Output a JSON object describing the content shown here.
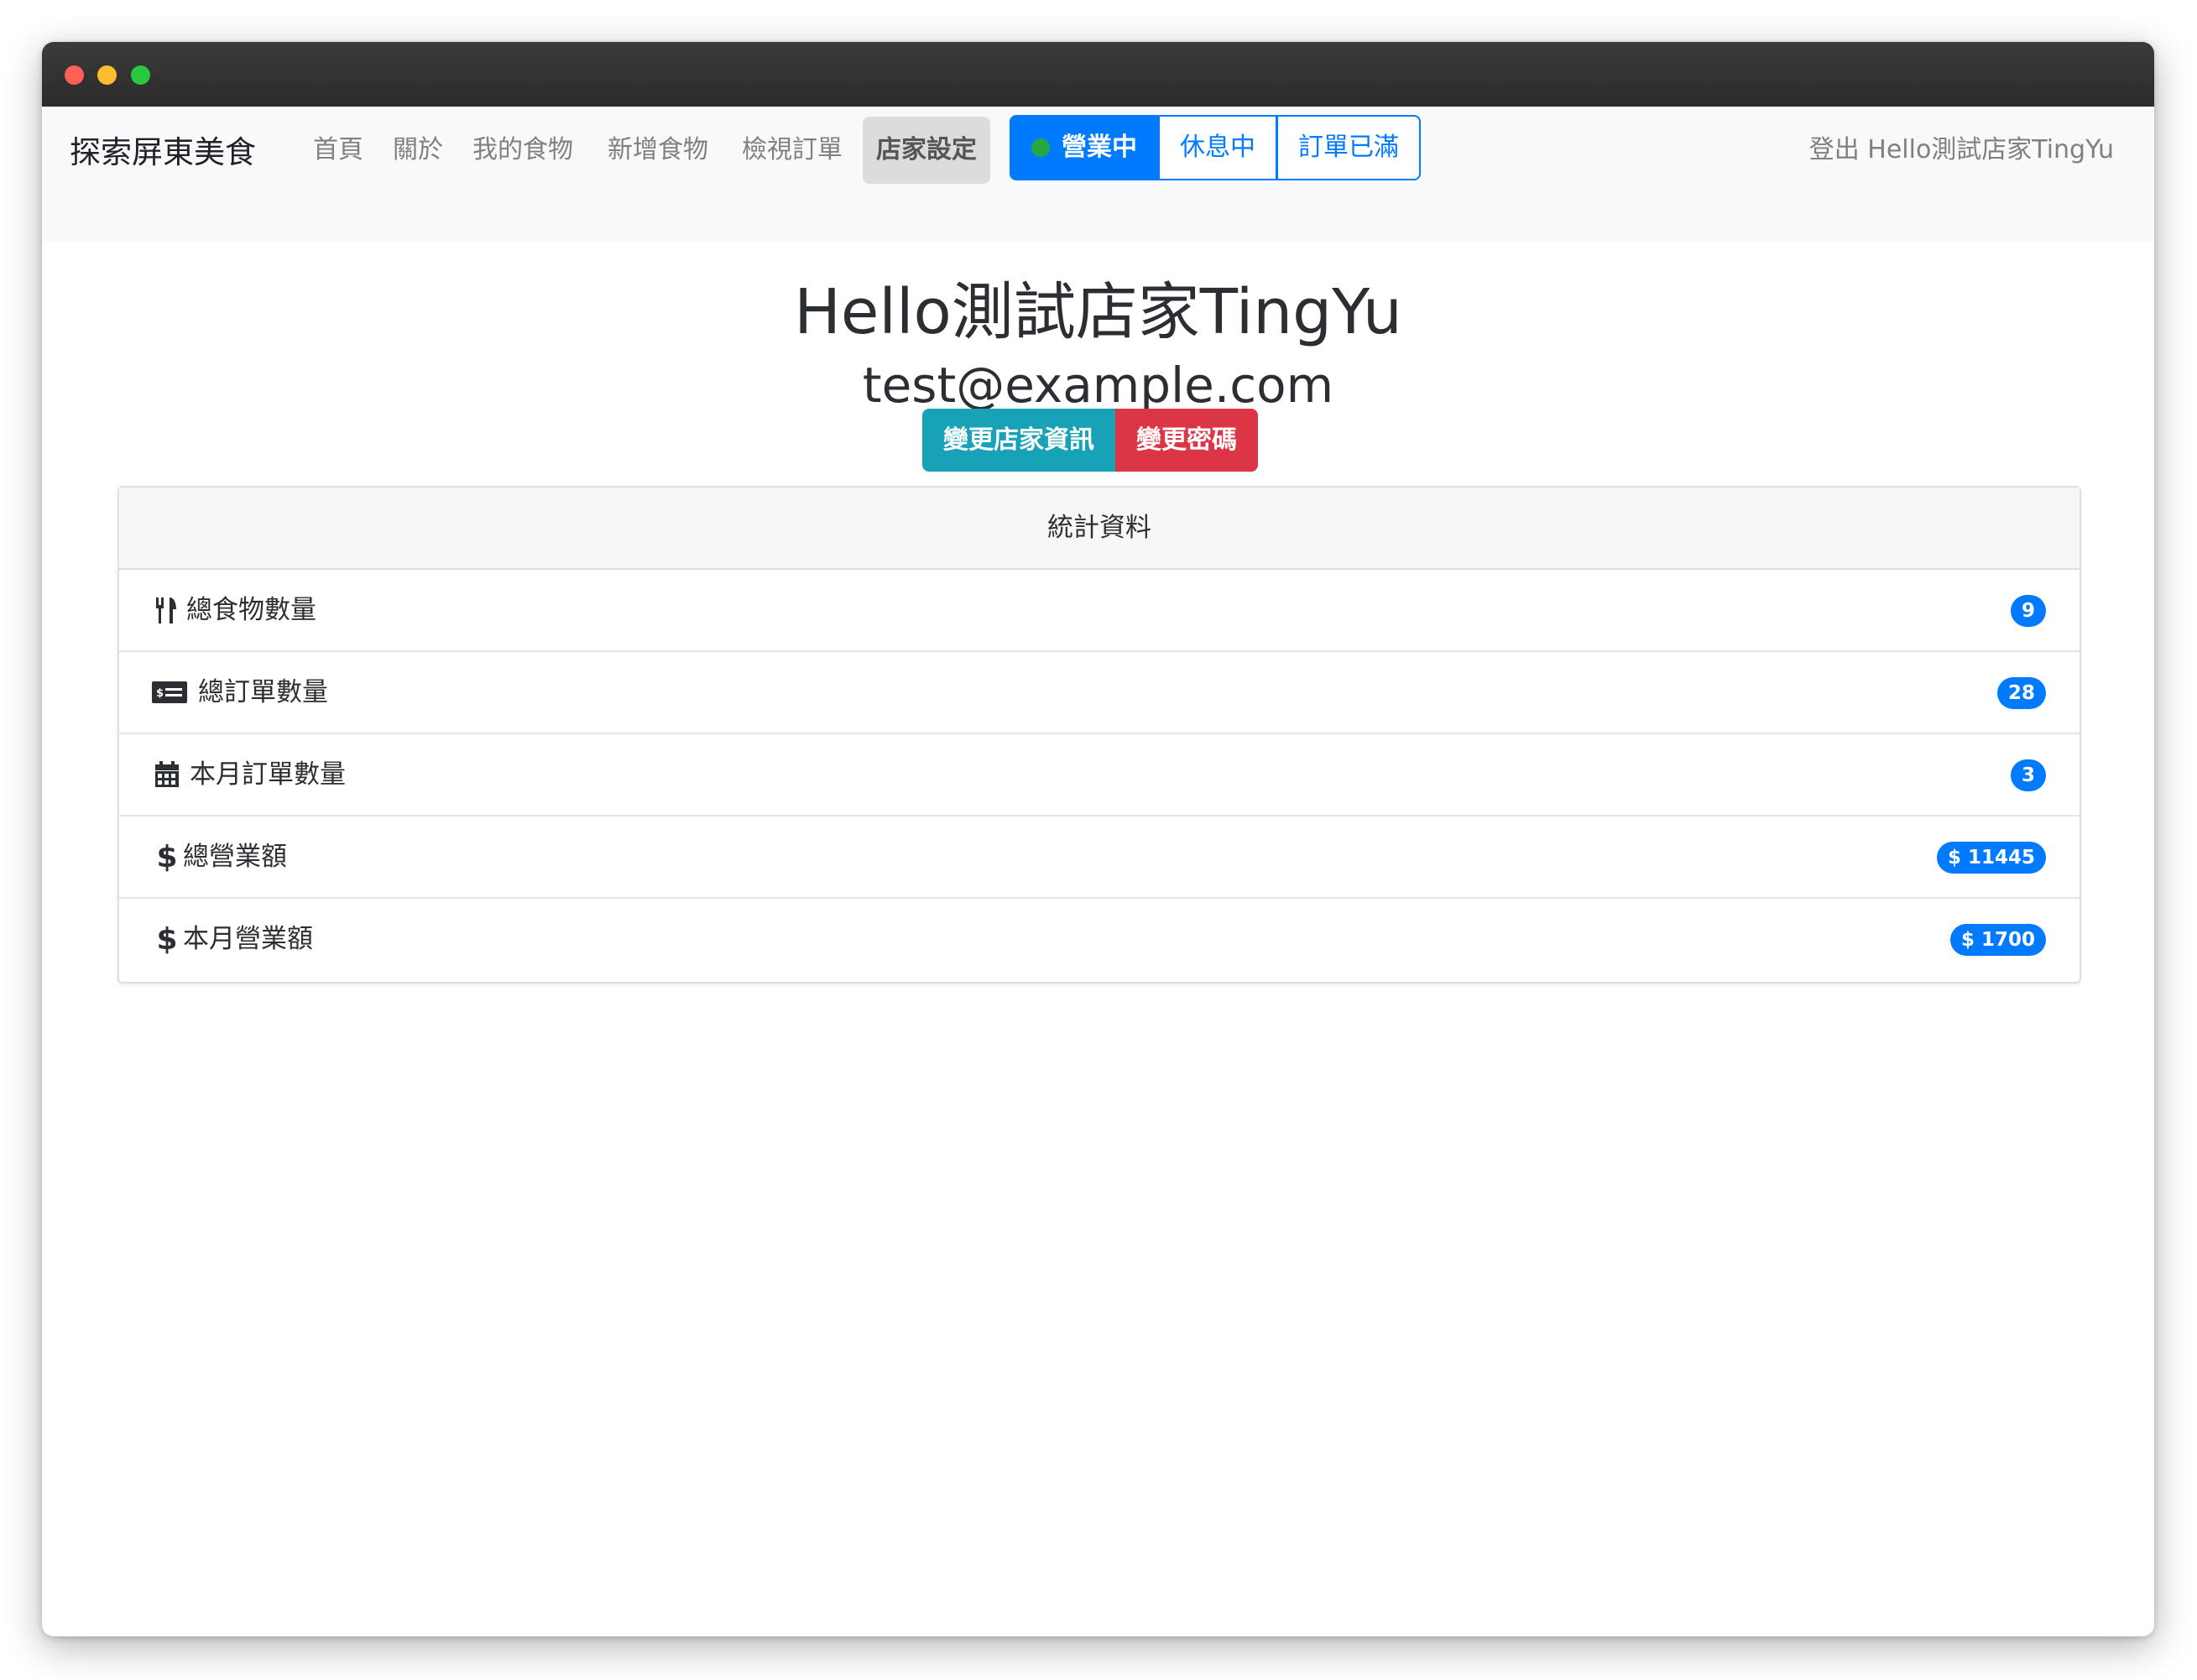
{
  "nav": {
    "brand": "探索屏東美食",
    "links": [
      "首頁",
      "關於",
      "我的食物",
      "新增食物",
      "檢視訂單",
      "店家設定"
    ],
    "active_link": "店家設定",
    "status_buttons": [
      "營業中",
      "休息中",
      "訂單已滿"
    ],
    "logout": "登出 Hello測試店家TingYu"
  },
  "profile": {
    "name": "Hello測試店家TingYu",
    "email": "test@example.com",
    "edit_button": "變更店家資訊",
    "password_button": "變更密碼"
  },
  "stats": {
    "header": "統計資料",
    "items": [
      {
        "label": "總食物數量",
        "value": "9",
        "icon": "utensils-icon"
      },
      {
        "label": "總訂單數量",
        "value": "28",
        "icon": "money-bill-icon"
      },
      {
        "label": "本月訂單數量",
        "value": "3",
        "icon": "calendar-icon"
      },
      {
        "label": "總營業額",
        "value": "$ 11445",
        "icon": "dollar-icon"
      },
      {
        "label": "本月營業額",
        "value": "$ 1700",
        "icon": "dollar-icon"
      }
    ]
  },
  "colors": {
    "primary": "#007bff",
    "info": "#17a2b8",
    "danger": "#dc3545",
    "success": "#28a745"
  }
}
